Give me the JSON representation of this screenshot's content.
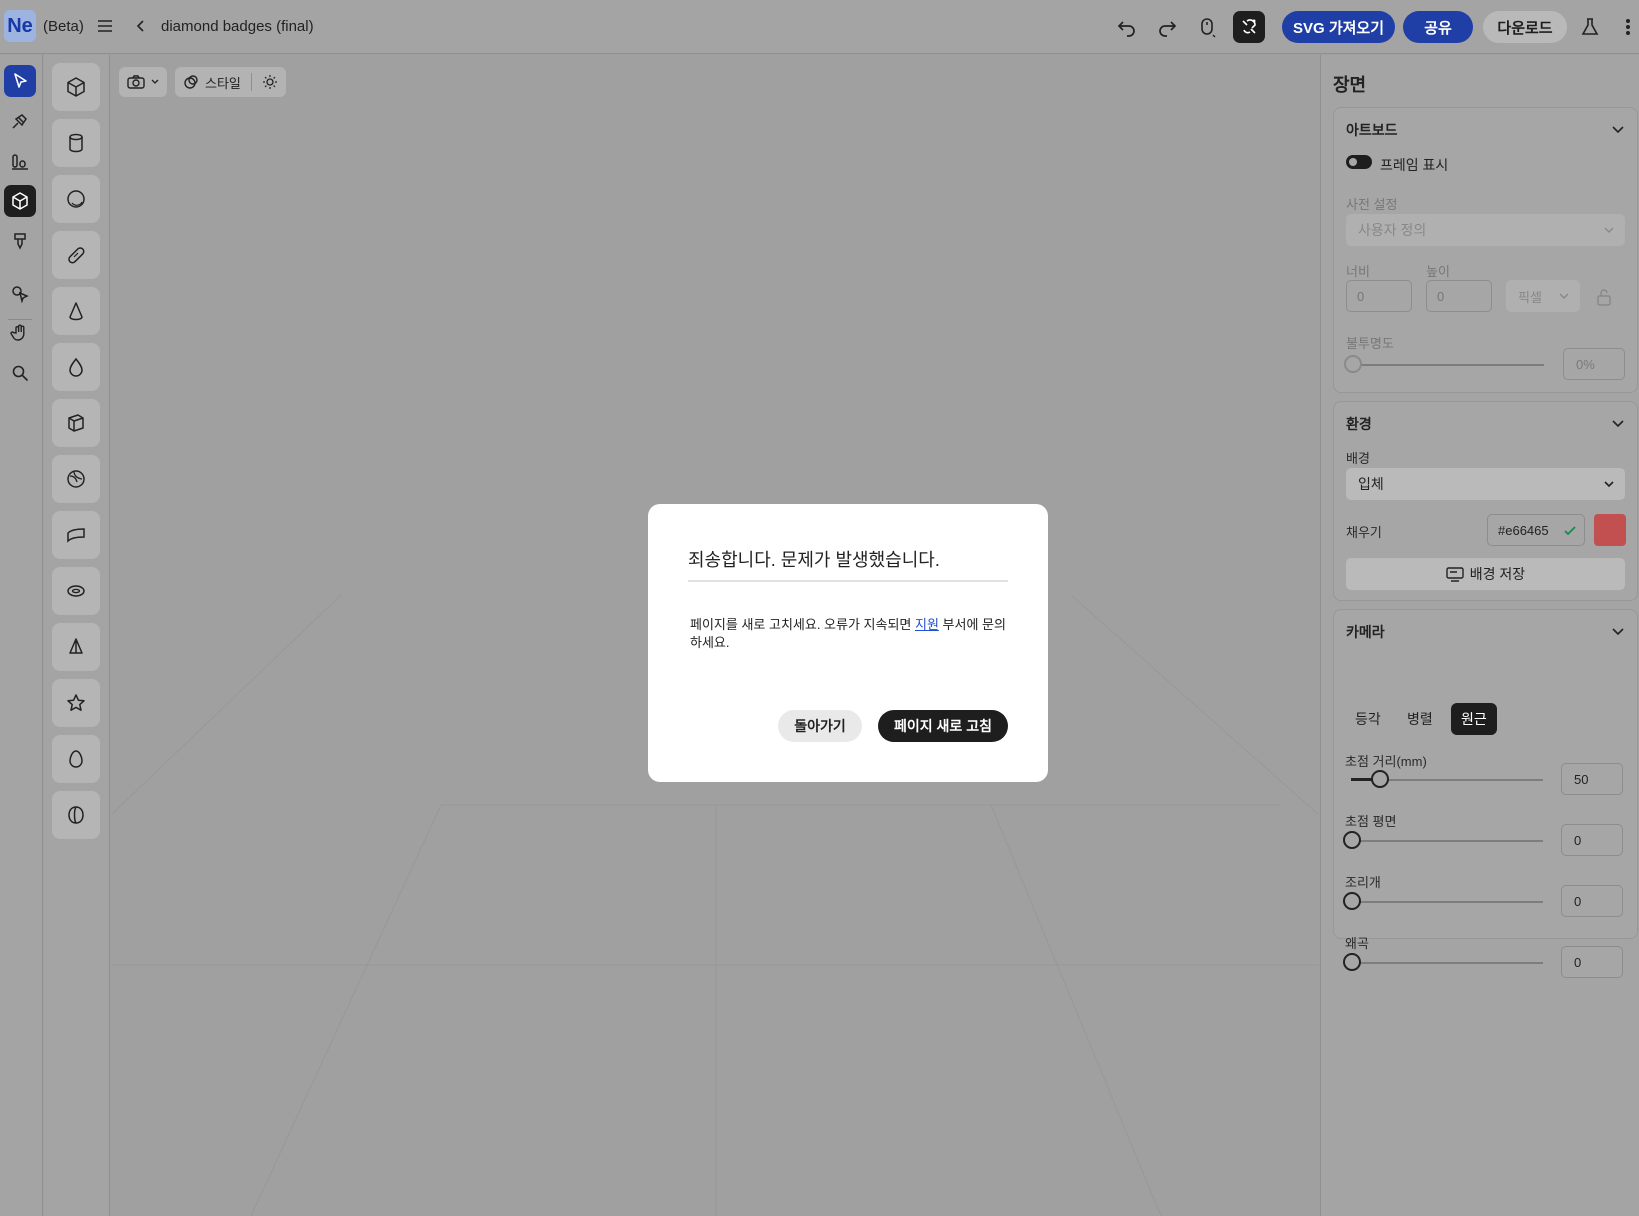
{
  "app": {
    "logo_text": "Ne",
    "beta_label": "(Beta)",
    "document_title": "diamond badges (final)"
  },
  "toolbar": {
    "import_svg_label": "SVG 가져오기",
    "share_label": "공유",
    "download_label": "다운로드"
  },
  "canvas_toolbar": {
    "style_label": "스타일"
  },
  "right_panel": {
    "title": "장면",
    "artboard": {
      "header": "아트보드",
      "show_frame_label": "프레임 표시",
      "preset_label": "사전 설정",
      "preset_value": "사용자 정의",
      "width_label": "너비",
      "width_value": "0",
      "height_label": "높이",
      "height_value": "0",
      "unit_value": "픽셀",
      "opacity_label": "불투명도",
      "opacity_value": "0%"
    },
    "environment": {
      "header": "환경",
      "background_label": "배경",
      "background_value": "입체",
      "fill_label": "채우기",
      "fill_hex": "#e66465",
      "save_background_label": "배경 저장"
    },
    "camera": {
      "header": "카메라",
      "tabs": [
        "등각",
        "병렬",
        "원근"
      ],
      "active_tab": "원근",
      "focal_length_label": "초점 거리(mm)",
      "focal_length_value": "50",
      "focal_plane_label": "초점 평면",
      "focal_plane_value": "0",
      "aperture_label": "조리개",
      "aperture_value": "0",
      "distortion_label": "왜곡",
      "distortion_value": "0"
    }
  },
  "modal": {
    "title": "죄송합니다. 문제가 발생했습니다.",
    "body_before_link": "페이지를 새로 고치세요. 오류가 지속되면 ",
    "link_text": "지원",
    "body_after_link": " 부서에 문의하세요.",
    "back_label": "돌아가기",
    "refresh_label": "페이지 새로 고침"
  },
  "colors": {
    "accent_blue": "#1f3ea6",
    "dark": "#1e1e1e",
    "fill_swatch": "#c25050",
    "check_green": "#1a8a4a",
    "link_blue": "#1f4fd6"
  }
}
